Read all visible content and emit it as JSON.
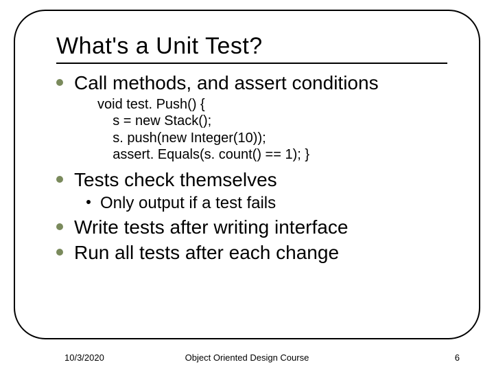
{
  "title": "What's a Unit Test?",
  "bullets": {
    "b0": "Call methods, and assert conditions",
    "code": "void test. Push() {\n    s = new Stack();\n    s. push(new Integer(10));\n    assert. Equals(s. count() == 1); }",
    "b1": "Tests check themselves",
    "b1sub": "Only output if a test fails",
    "b2": "Write tests after writing interface",
    "b3": "Run all tests after each change"
  },
  "footer": {
    "date": "10/3/2020",
    "course": "Object Oriented Design Course",
    "page": "6"
  }
}
